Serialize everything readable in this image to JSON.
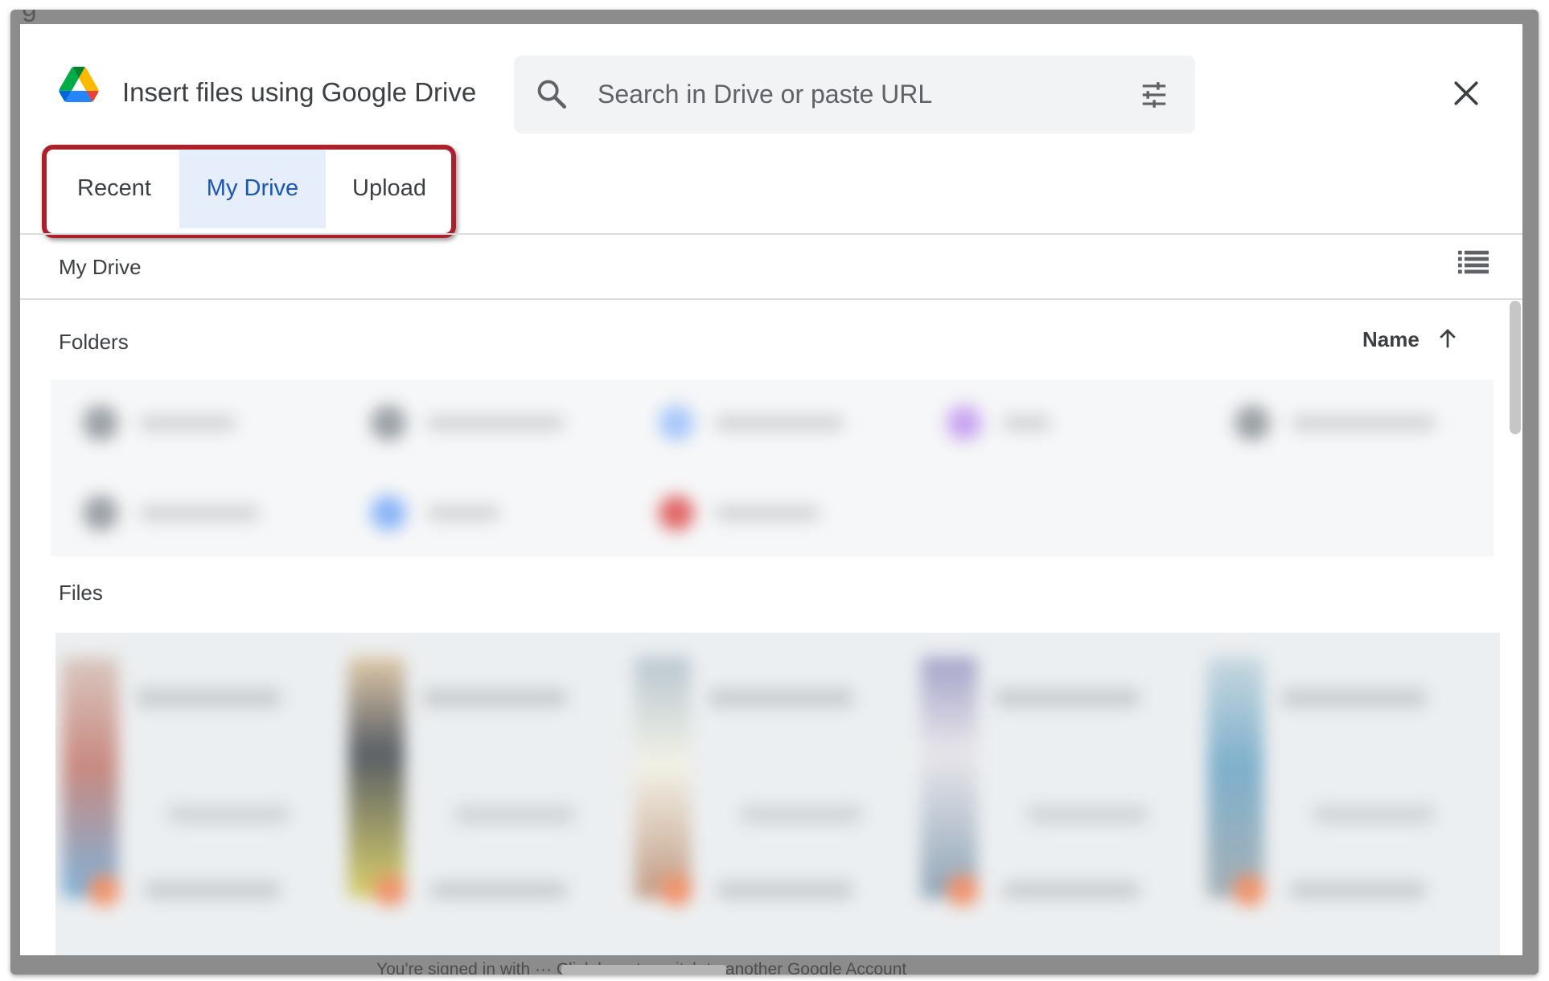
{
  "dialog": {
    "title": "Insert files using Google Drive",
    "search_placeholder": "Search in Drive or paste URL",
    "tabs": [
      {
        "label": "Recent",
        "active": false
      },
      {
        "label": "My Drive",
        "active": true
      },
      {
        "label": "Upload",
        "active": false
      }
    ],
    "breadcrumb": "My Drive",
    "sections": {
      "folders_label": "Folders",
      "files_label": "Files"
    },
    "sort": {
      "label": "Name",
      "direction": "ascending",
      "icon": "arrow-up-icon"
    },
    "icons": [
      "google-drive-logo",
      "search-icon",
      "tune-icon",
      "close-icon",
      "list-view-icon",
      "arrow-up-icon"
    ],
    "colors": {
      "active_tab_bg": "#e6eefb",
      "active_tab_text": "#1a57b3",
      "highlight_box": "#ad1f2b",
      "search_bg": "#f1f3f4"
    }
  },
  "footer": {
    "partial_text": "You're signed in with ··· Click here to switch to another Google Account"
  }
}
